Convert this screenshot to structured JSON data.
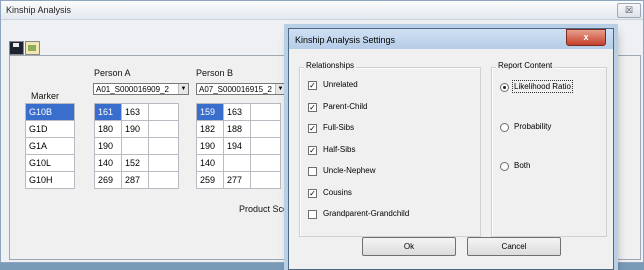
{
  "main": {
    "title": "Kinship Analysis",
    "close_glyph": "☒",
    "toolbar": {
      "save_icon": "save-icon",
      "open_icon": "open-icon"
    },
    "marker_header": "Marker",
    "personA": {
      "label": "Person A",
      "sample": "A01_S000016909_2"
    },
    "personB": {
      "label": "Person B",
      "sample": "A07_S000016915_2"
    },
    "markers": [
      "G10B",
      "G1D",
      "G1A",
      "G10L",
      "G10H"
    ],
    "alleles_a": [
      [
        "161",
        "163"
      ],
      [
        "180",
        "190"
      ],
      [
        "190",
        ""
      ],
      [
        "140",
        "152"
      ],
      [
        "269",
        "287"
      ]
    ],
    "alleles_b": [
      [
        "159",
        "163"
      ],
      [
        "182",
        "188"
      ],
      [
        "190",
        "194"
      ],
      [
        "140",
        ""
      ],
      [
        "259",
        "277"
      ]
    ],
    "product_score_label": "Product Score"
  },
  "dialog": {
    "title": "Kinship Analysis Settings",
    "close_glyph": "x",
    "relationships_legend": "Relationships",
    "relationships": [
      {
        "label": "Unrelated",
        "checked": true
      },
      {
        "label": "Parent-Child",
        "checked": true
      },
      {
        "label": "Full-Sibs",
        "checked": true
      },
      {
        "label": "Half-Sibs",
        "checked": true
      },
      {
        "label": "Uncle-Nephew",
        "checked": false
      },
      {
        "label": "Cousins",
        "checked": true
      },
      {
        "label": "Grandparent-Grandchild",
        "checked": false
      }
    ],
    "report_legend": "Report Content",
    "report_options": [
      {
        "label": "Likelihood Ratio",
        "selected": true
      },
      {
        "label": "Probability",
        "selected": false
      },
      {
        "label": "Both",
        "selected": false
      }
    ],
    "ok_label": "Ok",
    "cancel_label": "Cancel"
  },
  "colors": {
    "selection": "#3a6ecc",
    "dialog_title": "#b6cde8",
    "close_button": "#c4402a"
  }
}
